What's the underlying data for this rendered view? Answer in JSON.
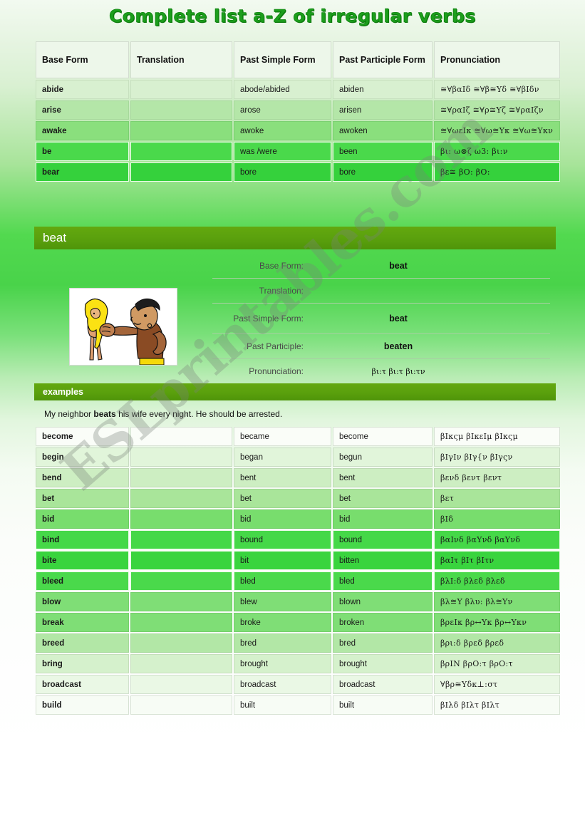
{
  "page": {
    "title": "Complete list a-Z of irregular verbs",
    "watermark": "ESLprintables.com",
    "accent_color": "#5aa00d",
    "title_color": "#1c9e1c"
  },
  "table1": {
    "headers": [
      "Base Form",
      "Translation",
      "Past Simple Form",
      "Past Participle Form",
      "Pronunciation"
    ],
    "rows": [
      {
        "base": "abide",
        "translation": "",
        "past_simple": "abode/abided",
        "past_participle": "abiden",
        "pronunciation": "≅∀βαΙδ  ≅∀β≅Υδ  ≅∀βΙδν"
      },
      {
        "base": "arise",
        "translation": "",
        "past_simple": "arose",
        "past_participle": "arisen",
        "pronunciation": "≅∀ραΙζ   ≅∀ρ≅Υζ   ≅∀ραΙζν"
      },
      {
        "base": "awake",
        "translation": "",
        "past_simple": "awoke",
        "past_participle": "awoken",
        "pronunciation": "≅∀ωεΙκ  ≅∀ω≅Υκ  ≅∀ω≅Υκν"
      },
      {
        "base": "be",
        "translation": "",
        "past_simple": "was /were",
        "past_participle": "been",
        "pronunciation": "βι:    ω⊗ζ ω3:   βι:ν"
      },
      {
        "base": "bear",
        "translation": "",
        "past_simple": "bore",
        "past_participle": "bore",
        "pronunciation": "βε≅    βΟ:     βΟ:"
      }
    ]
  },
  "beat_detail": {
    "heading": "beat",
    "image_alt": "cartoon man punching a blonde woman",
    "fields": [
      {
        "label": "Base Form:",
        "value": "beat"
      },
      {
        "label": "Translation:",
        "value": ""
      },
      {
        "label": "Past Simple Form:",
        "value": "beat"
      },
      {
        "label": "Past Participle:",
        "value": "beaten"
      },
      {
        "label": "Pronunciation:",
        "value": "βι:τ    βι:τ   βι:τν"
      }
    ],
    "examples_heading": "examples",
    "example_prefix": "My neighbor ",
    "example_bold": "beats",
    "example_suffix": " his wife every night. He should be arrested."
  },
  "table2": {
    "rows": [
      {
        "base": "become",
        "translation": "",
        "past_simple": "became",
        "past_participle": "become",
        "pronunciation": "βΙκςμ  βΙκεΙμ  βΙκςμ"
      },
      {
        "base": "begin",
        "translation": "",
        "past_simple": "began",
        "past_participle": "begun",
        "pronunciation": "βΙγΙν   βΙγ{ν  βΙγςν"
      },
      {
        "base": "bend",
        "translation": "",
        "past_simple": "bent",
        "past_participle": "bent",
        "pronunciation": "βενδ  βεντ  βεντ"
      },
      {
        "base": "bet",
        "translation": "",
        "past_simple": "bet",
        "past_participle": "bet",
        "pronunciation": "βετ"
      },
      {
        "base": "bid",
        "translation": "",
        "past_simple": "bid",
        "past_participle": "bid",
        "pronunciation": "βΙδ"
      },
      {
        "base": "bind",
        "translation": "",
        "past_simple": "bound",
        "past_participle": "bound",
        "pronunciation": "βαΙνδ  βαΥνδ  βαΥνδ"
      },
      {
        "base": "bite",
        "translation": "",
        "past_simple": "bit",
        "past_participle": "bitten",
        "pronunciation": "βαΙτ  βΙτ  βΙτν"
      },
      {
        "base": "bleed",
        "translation": "",
        "past_simple": "bled",
        "past_participle": "bled",
        "pronunciation": "βλΙ:δ  βλεδ  βλεδ"
      },
      {
        "base": "blow",
        "translation": "",
        "past_simple": "blew",
        "past_participle": "blown",
        "pronunciation": "βλ≅Υ   βλυ:  βλ≅Υν"
      },
      {
        "base": "break",
        "translation": "",
        "past_simple": "broke",
        "past_participle": "broken",
        "pronunciation": "βρεΙκ  βρ↔Υκ  βρ↔Υκν"
      },
      {
        "base": "breed",
        "translation": "",
        "past_simple": "bred",
        "past_participle": "bred",
        "pronunciation": "βρι:δ   βρεδ  βρεδ"
      },
      {
        "base": "bring",
        "translation": "",
        "past_simple": "brought",
        "past_participle": "brought",
        "pronunciation": "βρΙΝ βρΟ:τ   βρΟ:τ"
      },
      {
        "base": "broadcast",
        "translation": "",
        "past_simple": "broadcast",
        "past_participle": "broadcast",
        "pronunciation": "∀βρ≅Υδκ⊥:στ"
      },
      {
        "base": "build",
        "translation": "",
        "past_simple": "built",
        "past_participle": "built",
        "pronunciation": "βΙλδ  βΙλτ    βΙλτ"
      }
    ]
  }
}
